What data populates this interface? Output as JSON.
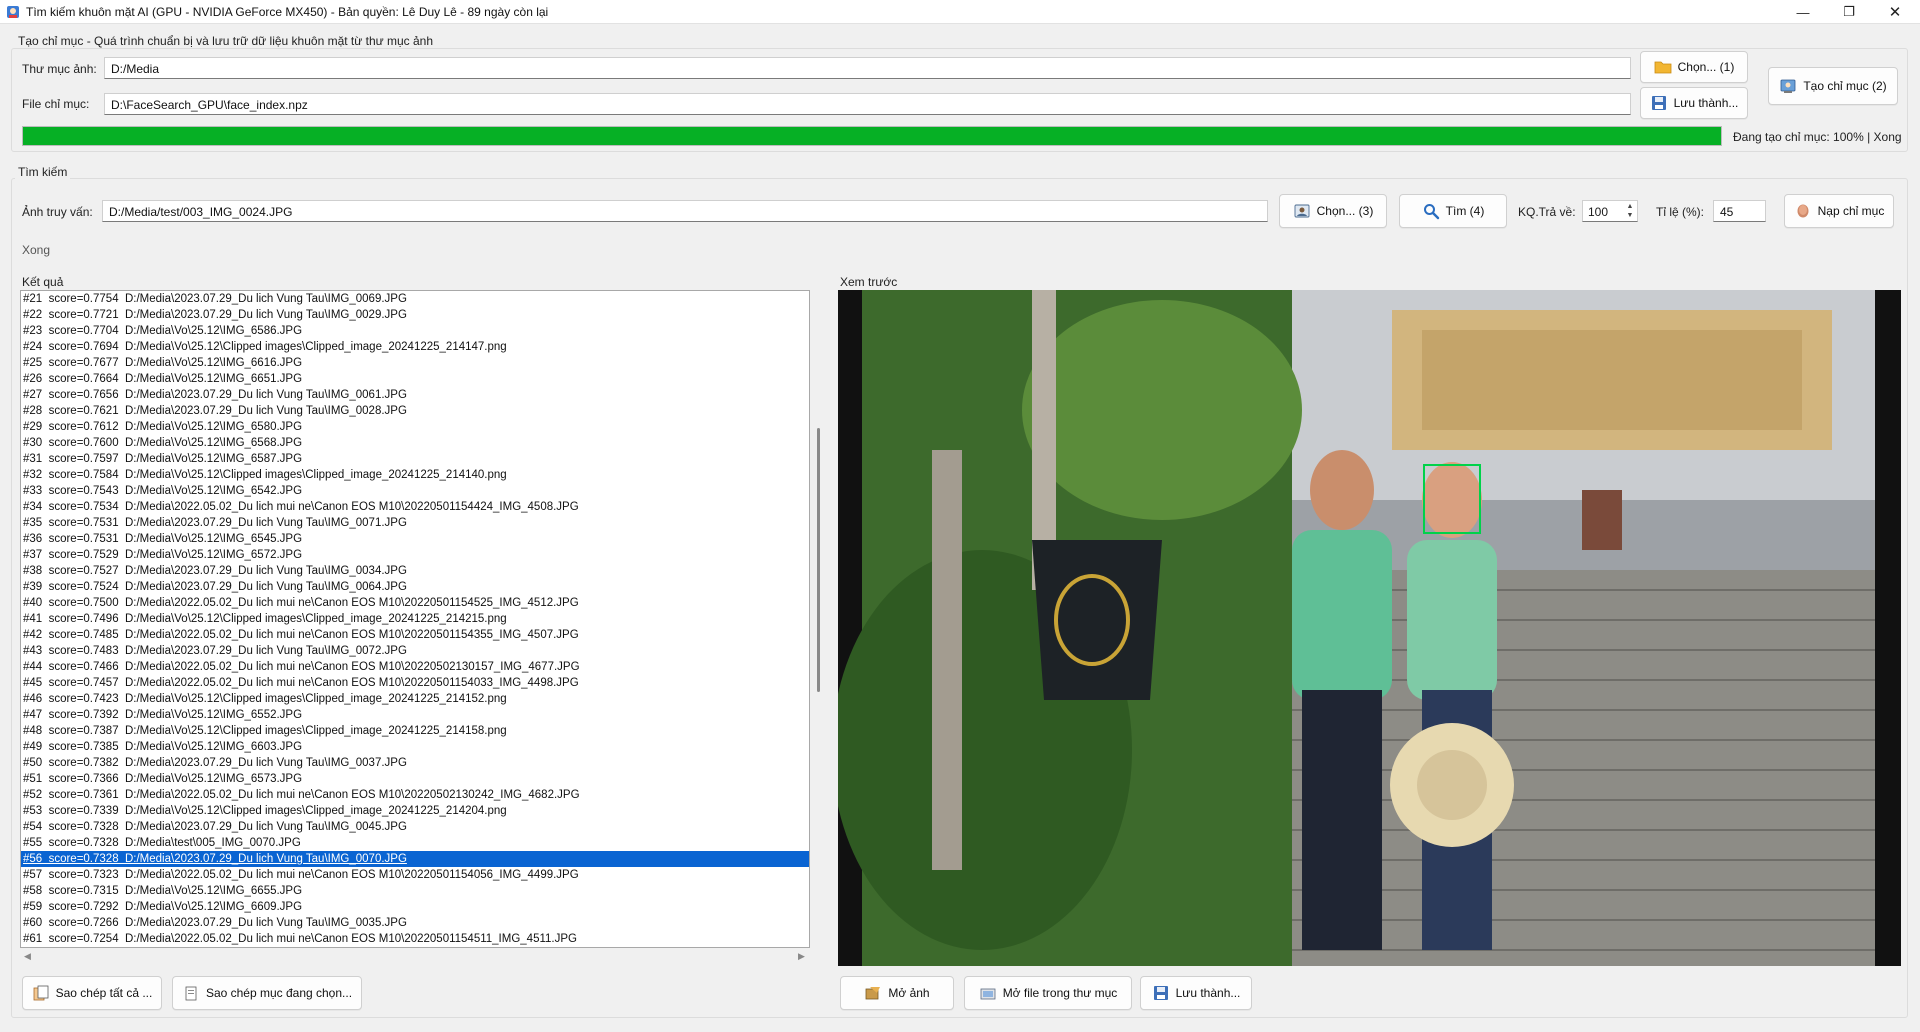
{
  "window": {
    "title": "Tìm kiếm khuôn mặt AI (GPU - NVIDIA GeForce MX450) - Bản quyền: Lê Duy Lê - 89 ngày còn lại",
    "minimize": "—",
    "maximize": "❐",
    "close": "✕"
  },
  "index_group": {
    "title": "Tạo chỉ mục - Quá trình chuẩn bị và lưu trữ dữ liệu khuôn mặt từ thư mục ảnh",
    "image_folder_label": "Thư mục ảnh:",
    "image_folder_value": "D:/Media",
    "index_file_label": "File chỉ mục:",
    "index_file_value": "D:\\FaceSearch_GPU\\face_index.npz",
    "choose_button": "Chọn... (1)",
    "save_as_button": "Lưu thành...",
    "create_index_button": "Tạo chỉ mục (2)",
    "progress_percent": 100,
    "progress_status": "Đang tạo chỉ mục: 100% | Xong"
  },
  "search_group": {
    "title": "Tìm kiếm",
    "query_label": "Ảnh truy vấn:",
    "query_value": "D:/Media/test/003_IMG_0024.JPG",
    "choose_button": "Chọn... (3)",
    "search_button": "Tìm (4)",
    "top_k_label": "KQ.Trả về:",
    "top_k_value": "100",
    "ratio_label": "Tỉ lệ (%):",
    "ratio_value": "45",
    "load_index_button": "Nạp chỉ mục",
    "status": "Xong"
  },
  "results": {
    "label": "Kết quả",
    "selected_index": 35,
    "rows": [
      "#21  score=0.7754  D:/Media\\2023.07.29_Du lich Vung Tau\\IMG_0069.JPG",
      "#22  score=0.7721  D:/Media\\2023.07.29_Du lich Vung Tau\\IMG_0029.JPG",
      "#23  score=0.7704  D:/Media\\Vo\\25.12\\IMG_6586.JPG",
      "#24  score=0.7694  D:/Media\\Vo\\25.12\\Clipped images\\Clipped_image_20241225_214147.png",
      "#25  score=0.7677  D:/Media\\Vo\\25.12\\IMG_6616.JPG",
      "#26  score=0.7664  D:/Media\\Vo\\25.12\\IMG_6651.JPG",
      "#27  score=0.7656  D:/Media\\2023.07.29_Du lich Vung Tau\\IMG_0061.JPG",
      "#28  score=0.7621  D:/Media\\2023.07.29_Du lich Vung Tau\\IMG_0028.JPG",
      "#29  score=0.7612  D:/Media\\Vo\\25.12\\IMG_6580.JPG",
      "#30  score=0.7600  D:/Media\\Vo\\25.12\\IMG_6568.JPG",
      "#31  score=0.7597  D:/Media\\Vo\\25.12\\IMG_6587.JPG",
      "#32  score=0.7584  D:/Media\\Vo\\25.12\\Clipped images\\Clipped_image_20241225_214140.png",
      "#33  score=0.7543  D:/Media\\Vo\\25.12\\IMG_6542.JPG",
      "#34  score=0.7534  D:/Media\\2022.05.02_Du lich mui ne\\Canon EOS M10\\20220501154424_IMG_4508.JPG",
      "#35  score=0.7531  D:/Media\\2023.07.29_Du lich Vung Tau\\IMG_0071.JPG",
      "#36  score=0.7531  D:/Media\\Vo\\25.12\\IMG_6545.JPG",
      "#37  score=0.7529  D:/Media\\Vo\\25.12\\IMG_6572.JPG",
      "#38  score=0.7527  D:/Media\\2023.07.29_Du lich Vung Tau\\IMG_0034.JPG",
      "#39  score=0.7524  D:/Media\\2023.07.29_Du lich Vung Tau\\IMG_0064.JPG",
      "#40  score=0.7500  D:/Media\\2022.05.02_Du lich mui ne\\Canon EOS M10\\20220501154525_IMG_4512.JPG",
      "#41  score=0.7496  D:/Media\\Vo\\25.12\\Clipped images\\Clipped_image_20241225_214215.png",
      "#42  score=0.7485  D:/Media\\2022.05.02_Du lich mui ne\\Canon EOS M10\\20220501154355_IMG_4507.JPG",
      "#43  score=0.7483  D:/Media\\2023.07.29_Du lich Vung Tau\\IMG_0072.JPG",
      "#44  score=0.7466  D:/Media\\2022.05.02_Du lich mui ne\\Canon EOS M10\\20220502130157_IMG_4677.JPG",
      "#45  score=0.7457  D:/Media\\2022.05.02_Du lich mui ne\\Canon EOS M10\\20220501154033_IMG_4498.JPG",
      "#46  score=0.7423  D:/Media\\Vo\\25.12\\Clipped images\\Clipped_image_20241225_214152.png",
      "#47  score=0.7392  D:/Media\\Vo\\25.12\\IMG_6552.JPG",
      "#48  score=0.7387  D:/Media\\Vo\\25.12\\Clipped images\\Clipped_image_20241225_214158.png",
      "#49  score=0.7385  D:/Media\\Vo\\25.12\\IMG_6603.JPG",
      "#50  score=0.7382  D:/Media\\2023.07.29_Du lich Vung Tau\\IMG_0037.JPG",
      "#51  score=0.7366  D:/Media\\Vo\\25.12\\IMG_6573.JPG",
      "#52  score=0.7361  D:/Media\\2022.05.02_Du lich mui ne\\Canon EOS M10\\20220502130242_IMG_4682.JPG",
      "#53  score=0.7339  D:/Media\\Vo\\25.12\\Clipped images\\Clipped_image_20241225_214204.png",
      "#54  score=0.7328  D:/Media\\2023.07.29_Du lich Vung Tau\\IMG_0045.JPG",
      "#55  score=0.7328  D:/Media\\test\\005_IMG_0070.JPG",
      "#56  score=0.7328  D:/Media\\2023.07.29_Du lich Vung Tau\\IMG_0070.JPG",
      "#57  score=0.7323  D:/Media\\2022.05.02_Du lich mui ne\\Canon EOS M10\\20220501154056_IMG_4499.JPG",
      "#58  score=0.7315  D:/Media\\Vo\\25.12\\IMG_6655.JPG",
      "#59  score=0.7292  D:/Media\\Vo\\25.12\\IMG_6609.JPG",
      "#60  score=0.7266  D:/Media\\2023.07.29_Du lich Vung Tau\\IMG_0035.JPG",
      "#61  score=0.7254  D:/Media\\2022.05.02_Du lich mui ne\\Canon EOS M10\\20220501154511_IMG_4511.JPG"
    ],
    "copy_all_button": "Sao chép tất cả ...",
    "copy_selected_button": "Sao chép mục đang chọn..."
  },
  "preview": {
    "label": "Xem trước",
    "open_image_button": "Mở ảnh",
    "open_in_folder_button": "Mở file trong thư mục",
    "save_as_button": "Lưu thành..."
  },
  "colors": {
    "progress_fill": "#06b025",
    "selection": "#0a64d2",
    "face_box": "#00d24a"
  },
  "icons": [
    "app-icon",
    "folder-icon",
    "save-icon",
    "index-icon",
    "image-icon",
    "search-icon",
    "face-icon",
    "copy-icon",
    "open-image-icon",
    "open-folder-icon"
  ]
}
